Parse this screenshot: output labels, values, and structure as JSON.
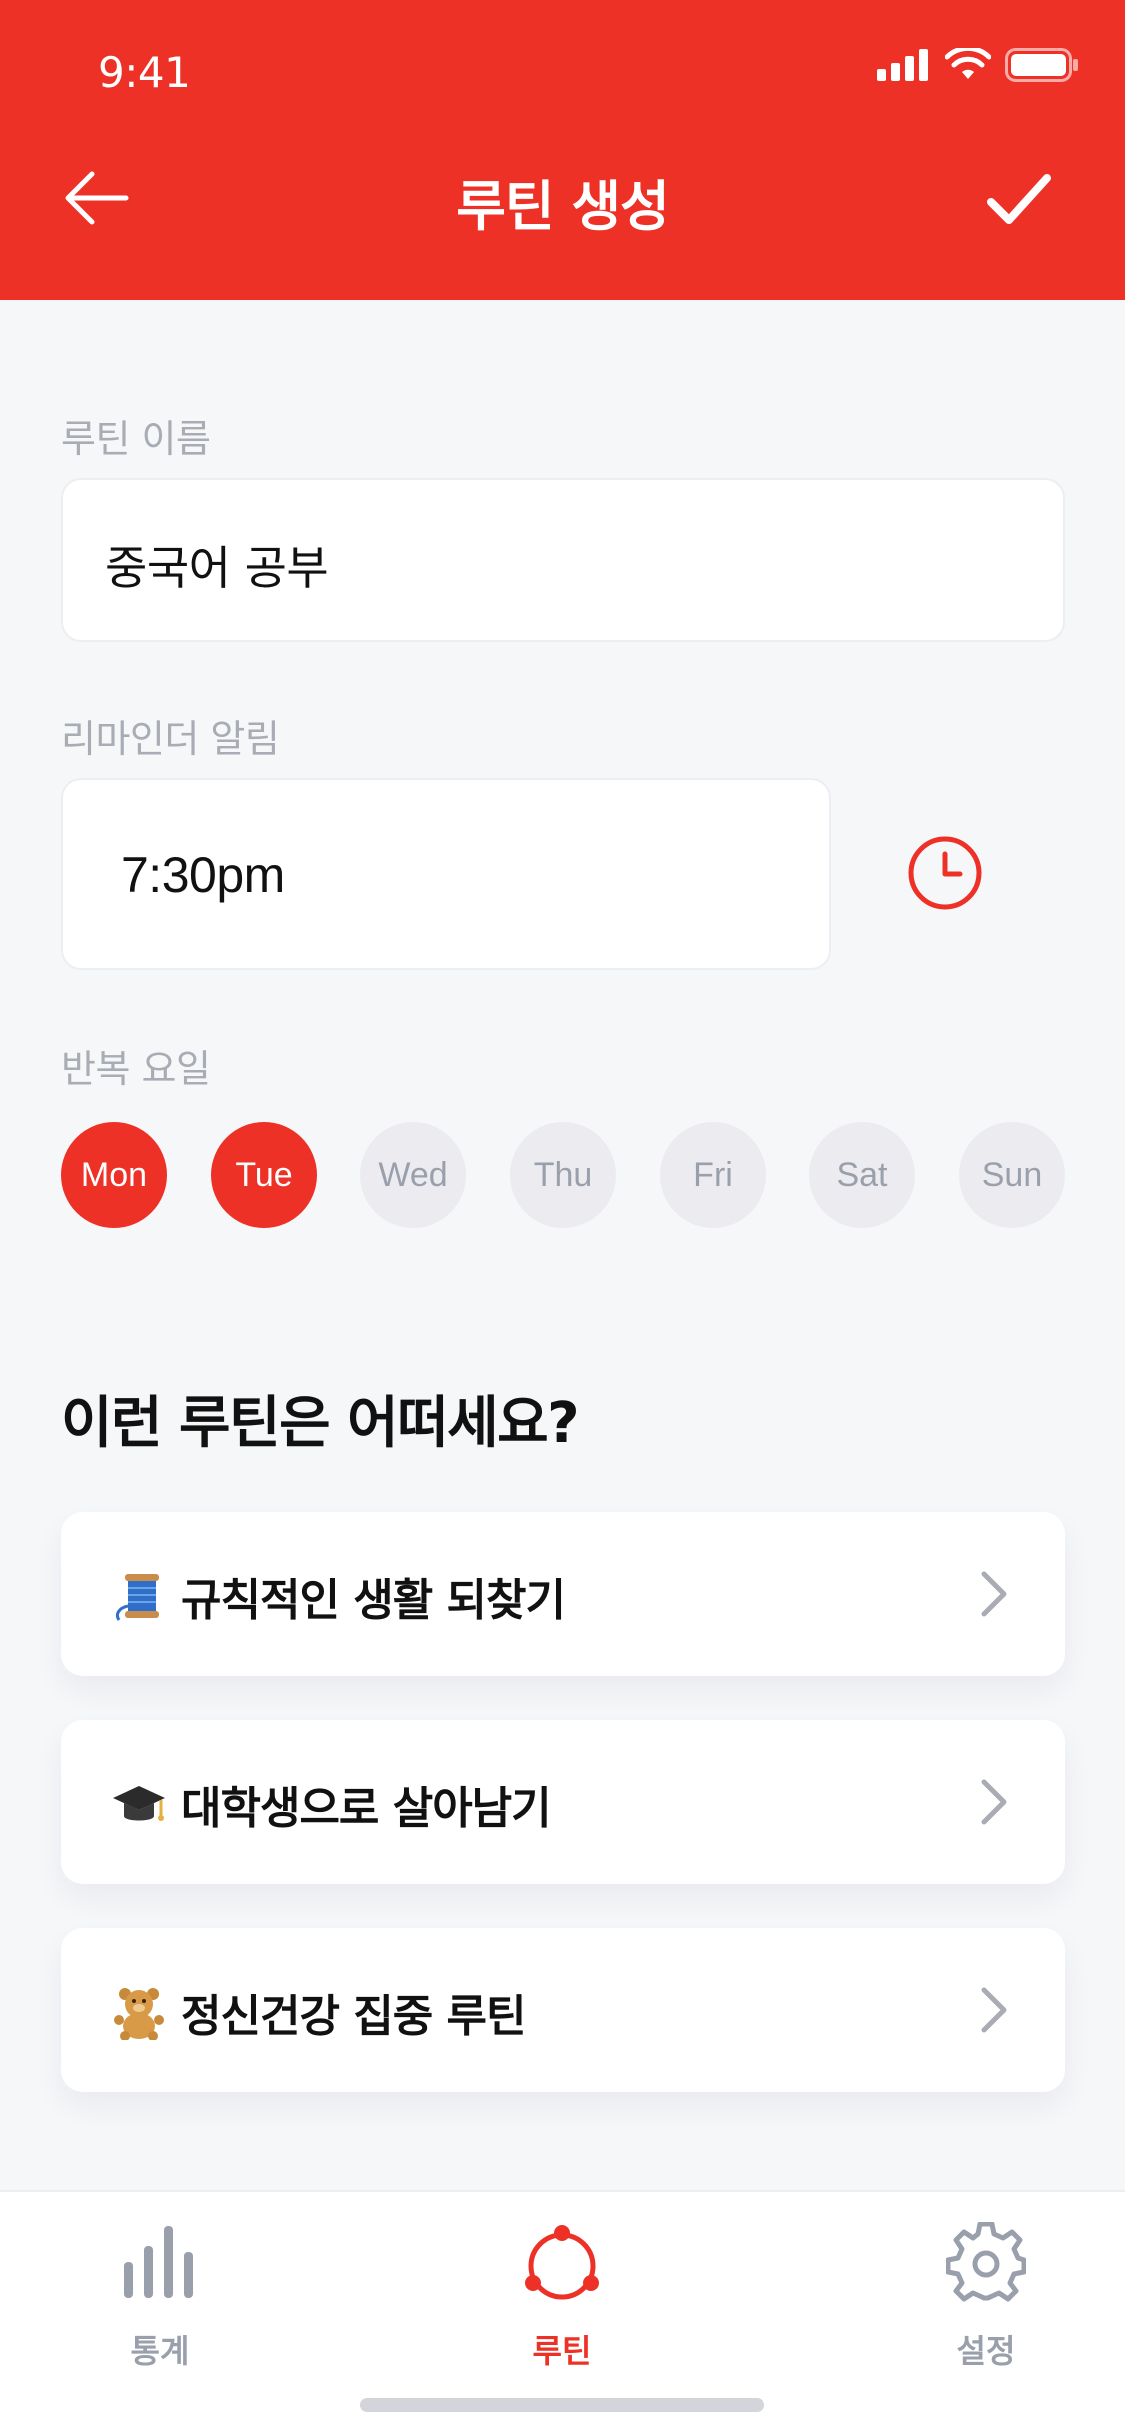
{
  "status_bar": {
    "time": "9:41"
  },
  "header": {
    "title": "루틴 생성",
    "back_icon": "arrow-left-icon",
    "confirm_icon": "check-icon"
  },
  "form": {
    "name_label": "루틴 이름",
    "name_value": "중국어 공부",
    "reminder_label": "리마인더 알림",
    "reminder_value": "7:30pm",
    "repeat_label": "반복 요일",
    "days": [
      {
        "label": "Mon",
        "selected": true
      },
      {
        "label": "Tue",
        "selected": true
      },
      {
        "label": "Wed",
        "selected": false
      },
      {
        "label": "Thu",
        "selected": false
      },
      {
        "label": "Fri",
        "selected": false
      },
      {
        "label": "Sat",
        "selected": false
      },
      {
        "label": "Sun",
        "selected": false
      }
    ]
  },
  "suggestions": {
    "title": "이런 루틴은 어떠세요?",
    "items": [
      {
        "icon": "thread-spool-icon",
        "label": "규칙적인 생활 되찾기"
      },
      {
        "icon": "graduation-cap-icon",
        "label": "대학생으로 살아남기"
      },
      {
        "icon": "teddy-bear-icon",
        "label": "정신건강 집중 루틴"
      }
    ]
  },
  "tabbar": {
    "items": [
      {
        "label": "통계",
        "icon": "bar-chart-icon",
        "active": false
      },
      {
        "label": "루틴",
        "icon": "routine-cycle-icon",
        "active": true
      },
      {
        "label": "설정",
        "icon": "gear-icon",
        "active": false
      }
    ]
  },
  "colors": {
    "accent": "#ee3127",
    "background": "#f6f7f9",
    "muted": "#a9acb4",
    "day_off_bg": "#ececf0"
  }
}
